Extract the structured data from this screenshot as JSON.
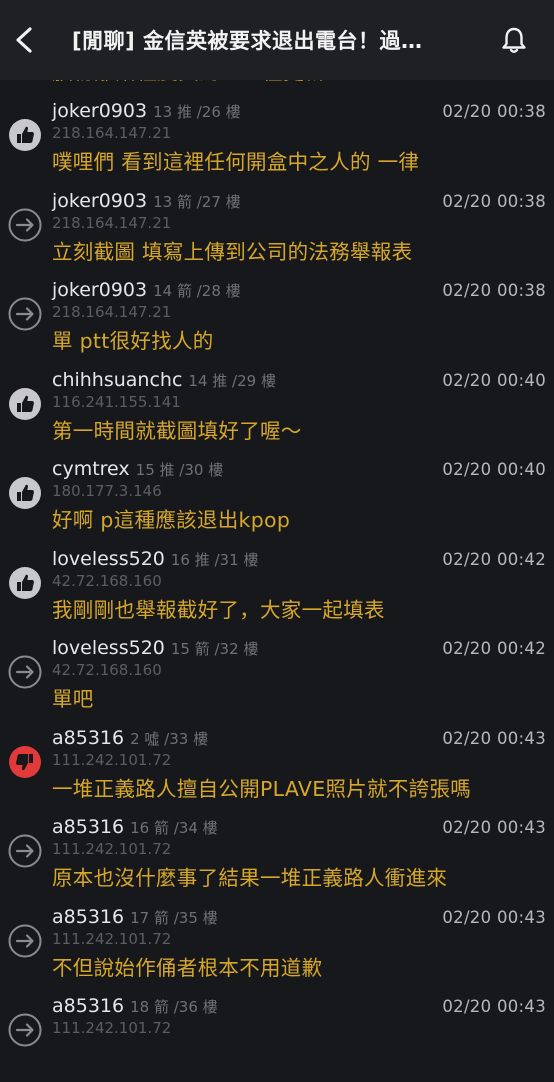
{
  "header": {
    "title": "[閒聊] 金信英被要求退出電台！過…",
    "back_icon": "chevron-left-icon",
    "bell_icon": "bell-icon"
  },
  "partial_comment": "腦粉離譜程度真的一直在更新",
  "colors": {
    "background": "#17181c",
    "header": "#1f2024",
    "comment_text": "#d6a72a",
    "push_icon": "#c8c8cc",
    "boo_icon": "#e23a3a"
  },
  "comments": [
    {
      "type": "push",
      "user": "joker0903",
      "meta": "13 推 /26 樓",
      "ip": "218.164.147.21",
      "time": "02/20 00:38",
      "content": "噗哩們 看到這裡任何開盒中之人的 一律"
    },
    {
      "type": "arrow",
      "user": "joker0903",
      "meta": "13 箭 /27 樓",
      "ip": "218.164.147.21",
      "time": "02/20 00:38",
      "content": "立刻截圖 填寫上傳到公司的法務舉報表"
    },
    {
      "type": "arrow",
      "user": "joker0903",
      "meta": "14 箭 /28 樓",
      "ip": "218.164.147.21",
      "time": "02/20 00:38",
      "content": "單 ptt很好找人的"
    },
    {
      "type": "push",
      "user": "chihhsuanchc",
      "meta": "14 推 /29 樓",
      "ip": "116.241.155.141",
      "time": "02/20 00:40",
      "content": "第一時間就截圖填好了喔～"
    },
    {
      "type": "push",
      "user": "cymtrex",
      "meta": "15 推 /30 樓",
      "ip": "180.177.3.146",
      "time": "02/20 00:40",
      "content": "好啊 p這種應該退出kpop"
    },
    {
      "type": "push",
      "user": "loveless520",
      "meta": "16 推 /31 樓",
      "ip": "42.72.168.160",
      "time": "02/20 00:42",
      "content": "我剛剛也舉報截好了，大家一起填表"
    },
    {
      "type": "arrow",
      "user": "loveless520",
      "meta": "15 箭 /32 樓",
      "ip": "42.72.168.160",
      "time": "02/20 00:42",
      "content": "單吧"
    },
    {
      "type": "boo",
      "user": "a85316",
      "meta": "2 噓 /33 樓",
      "ip": "111.242.101.72",
      "time": "02/20 00:43",
      "content": "一堆正義路人擅自公開PLAVE照片就不誇張嗎"
    },
    {
      "type": "arrow",
      "user": "a85316",
      "meta": "16 箭 /34 樓",
      "ip": "111.242.101.72",
      "time": "02/20 00:43",
      "content": "原本也沒什麼事了結果一堆正義路人衝進來"
    },
    {
      "type": "arrow",
      "user": "a85316",
      "meta": "17 箭 /35 樓",
      "ip": "111.242.101.72",
      "time": "02/20 00:43",
      "content": "不但說始作俑者根本不用道歉"
    },
    {
      "type": "arrow",
      "user": "a85316",
      "meta": "18 箭 /36 樓",
      "ip": "111.242.101.72",
      "time": "02/20 00:43",
      "content": ""
    }
  ]
}
